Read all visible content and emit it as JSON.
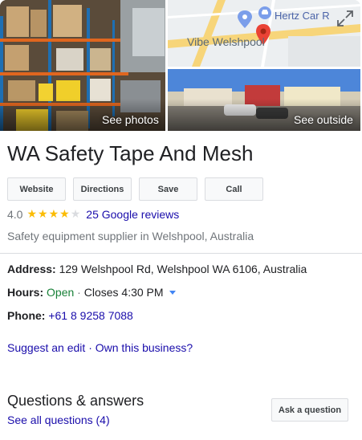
{
  "photos": {
    "see_photos": "See photos",
    "see_outside": "See outside",
    "map": {
      "poi_label": "Hertz Car R",
      "area_label": "Vibe Welshpool",
      "pin_color": "#ea4335"
    }
  },
  "business": {
    "name": "WA Safety Tape And Mesh",
    "rating": "4.0",
    "rating_value": 4.0,
    "reviews_link": "25 Google reviews",
    "category": "Safety equipment supplier in Welshpool, Australia"
  },
  "actions": [
    {
      "label": "Website"
    },
    {
      "label": "Directions"
    },
    {
      "label": "Save"
    },
    {
      "label": "Call"
    }
  ],
  "details": {
    "address_label": "Address:",
    "address_value": "129 Welshpool Rd, Welshpool WA 6106, Australia",
    "hours_label": "Hours:",
    "hours_status": "Open",
    "hours_sep": "·",
    "hours_close": "Closes 4:30 PM",
    "phone_label": "Phone:",
    "phone_value": "+61 8 9258 7088"
  },
  "edit": {
    "suggest": "Suggest an edit",
    "sep": "·",
    "own": "Own this business?"
  },
  "qa": {
    "title": "Questions & answers",
    "see_all": "See all questions (4)",
    "ask_button": "Ask a question"
  },
  "colors": {
    "link": "#1a0dab",
    "open": "#188038",
    "star": "#fbbc04",
    "muted": "#70757a"
  }
}
